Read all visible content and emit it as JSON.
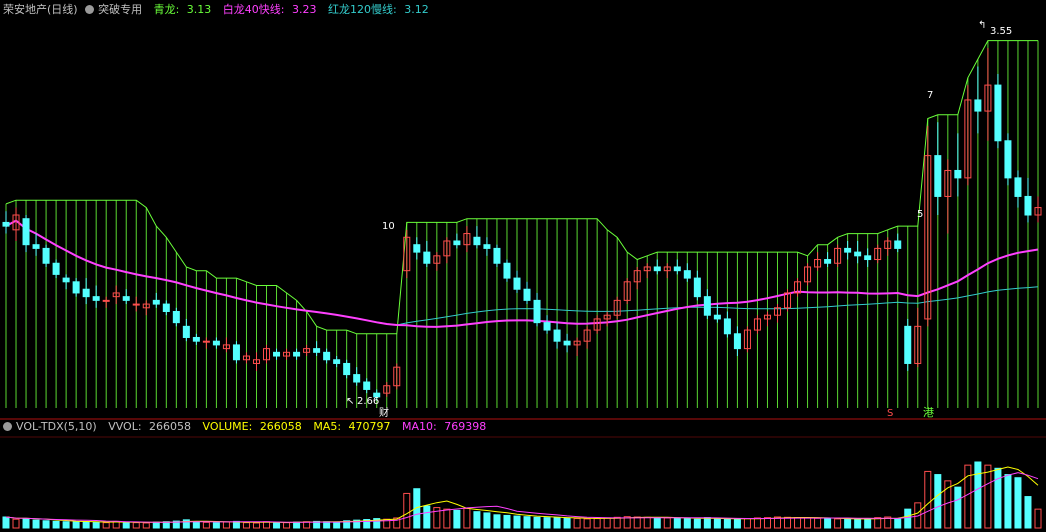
{
  "colors": {
    "up": "#ff4d4d",
    "down": "#54ffff",
    "green_band": "#6aff3a",
    "magenta": "#ff40ff",
    "cyan_line": "#33cccc",
    "yellow": "#ffff00",
    "white": "#ffffff",
    "separator": "#b01010"
  },
  "header": {
    "stock_name": "荣安地产(日线)",
    "indicator_name": "突破专用",
    "qinglong_label": "青龙: ",
    "qinglong_value": "3.13",
    "bailong_label": "白龙40快线: ",
    "bailong_value": "3.23",
    "honglong_label": "红龙120慢线: ",
    "honglong_value": "3.12"
  },
  "volume_header": {
    "name": "VOL-TDX(5,10)",
    "vvol_label": "VVOL: ",
    "vvol_value": "266058",
    "volume_label": "VOLUME: ",
    "volume_value": "266058",
    "ma5_label": "MA5: ",
    "ma5_value": "470797",
    "ma10_label": "MA10: ",
    "ma10_value": "769398"
  },
  "annotations": {
    "low_price": "2.66",
    "high_price": "3.55",
    "marker_cai": "财",
    "marker_s": "S",
    "marker_gang": "港",
    "num_10": "10",
    "num_7": "7",
    "num_5": "5"
  },
  "chart_data": [
    {
      "type": "candlestick",
      "title": "荣安地产(日线)",
      "ylim": [
        2.58,
        3.62
      ],
      "candles": [
        [
          3.08,
          3.11,
          3.05,
          3.07
        ],
        [
          3.06,
          3.12,
          3.03,
          3.1
        ],
        [
          3.09,
          3.1,
          3.0,
          3.02
        ],
        [
          3.02,
          3.05,
          2.99,
          3.01
        ],
        [
          3.01,
          3.02,
          2.96,
          2.97
        ],
        [
          2.97,
          2.98,
          2.93,
          2.94
        ],
        [
          2.93,
          2.94,
          2.9,
          2.92
        ],
        [
          2.92,
          2.93,
          2.88,
          2.89
        ],
        [
          2.9,
          2.93,
          2.86,
          2.88
        ],
        [
          2.88,
          2.91,
          2.85,
          2.87
        ],
        [
          2.87,
          2.88,
          2.85,
          2.87
        ],
        [
          2.88,
          2.91,
          2.86,
          2.89
        ],
        [
          2.88,
          2.9,
          2.86,
          2.87
        ],
        [
          2.86,
          2.88,
          2.84,
          2.86
        ],
        [
          2.85,
          2.87,
          2.83,
          2.86
        ],
        [
          2.87,
          2.89,
          2.85,
          2.86
        ],
        [
          2.86,
          2.87,
          2.83,
          2.84
        ],
        [
          2.84,
          2.85,
          2.8,
          2.81
        ],
        [
          2.8,
          2.82,
          2.76,
          2.77
        ],
        [
          2.77,
          2.78,
          2.75,
          2.76
        ],
        [
          2.76,
          2.77,
          2.74,
          2.76
        ],
        [
          2.76,
          2.77,
          2.74,
          2.75
        ],
        [
          2.74,
          2.77,
          2.73,
          2.75
        ],
        [
          2.75,
          2.76,
          2.7,
          2.71
        ],
        [
          2.71,
          2.73,
          2.7,
          2.72
        ],
        [
          2.7,
          2.73,
          2.68,
          2.71
        ],
        [
          2.71,
          2.75,
          2.7,
          2.74
        ],
        [
          2.73,
          2.74,
          2.71,
          2.72
        ],
        [
          2.72,
          2.74,
          2.71,
          2.73
        ],
        [
          2.73,
          2.74,
          2.71,
          2.72
        ],
        [
          2.73,
          2.75,
          2.72,
          2.74
        ],
        [
          2.74,
          2.76,
          2.72,
          2.73
        ],
        [
          2.73,
          2.74,
          2.7,
          2.71
        ],
        [
          2.71,
          2.72,
          2.69,
          2.7
        ],
        [
          2.7,
          2.71,
          2.66,
          2.67
        ],
        [
          2.67,
          2.69,
          2.64,
          2.65
        ],
        [
          2.65,
          2.66,
          2.62,
          2.63
        ],
        [
          2.62,
          2.63,
          2.6,
          2.61
        ],
        [
          2.62,
          2.65,
          2.61,
          2.64
        ],
        [
          2.64,
          2.7,
          2.63,
          2.69
        ],
        [
          2.95,
          3.06,
          2.93,
          3.04
        ],
        [
          3.02,
          3.04,
          2.98,
          3.0
        ],
        [
          3.0,
          3.03,
          2.96,
          2.97
        ],
        [
          2.97,
          3.0,
          2.95,
          2.99
        ],
        [
          2.99,
          3.04,
          2.97,
          3.03
        ],
        [
          3.03,
          3.05,
          3.01,
          3.02
        ],
        [
          3.02,
          3.07,
          3.0,
          3.05
        ],
        [
          3.04,
          3.07,
          3.01,
          3.02
        ],
        [
          3.02,
          3.04,
          2.99,
          3.01
        ],
        [
          3.01,
          3.02,
          2.96,
          2.97
        ],
        [
          2.97,
          2.98,
          2.92,
          2.93
        ],
        [
          2.93,
          2.95,
          2.89,
          2.9
        ],
        [
          2.9,
          2.92,
          2.86,
          2.87
        ],
        [
          2.87,
          2.89,
          2.8,
          2.81
        ],
        [
          2.81,
          2.83,
          2.78,
          2.79
        ],
        [
          2.79,
          2.81,
          2.74,
          2.76
        ],
        [
          2.76,
          2.78,
          2.73,
          2.75
        ],
        [
          2.75,
          2.77,
          2.72,
          2.76
        ],
        [
          2.76,
          2.8,
          2.74,
          2.79
        ],
        [
          2.79,
          2.83,
          2.78,
          2.82
        ],
        [
          2.82,
          2.84,
          2.8,
          2.83
        ],
        [
          2.83,
          2.88,
          2.82,
          2.87
        ],
        [
          2.87,
          2.93,
          2.86,
          2.92
        ],
        [
          2.92,
          2.96,
          2.9,
          2.95
        ],
        [
          2.95,
          2.97,
          2.93,
          2.96
        ],
        [
          2.96,
          2.98,
          2.94,
          2.95
        ],
        [
          2.95,
          2.97,
          2.93,
          2.96
        ],
        [
          2.96,
          2.98,
          2.94,
          2.95
        ],
        [
          2.95,
          2.97,
          2.92,
          2.93
        ],
        [
          2.93,
          2.95,
          2.87,
          2.88
        ],
        [
          2.88,
          2.9,
          2.82,
          2.83
        ],
        [
          2.83,
          2.86,
          2.81,
          2.82
        ],
        [
          2.82,
          2.84,
          2.77,
          2.78
        ],
        [
          2.78,
          2.8,
          2.72,
          2.74
        ],
        [
          2.74,
          2.8,
          2.73,
          2.79
        ],
        [
          2.79,
          2.83,
          2.78,
          2.82
        ],
        [
          2.82,
          2.84,
          2.8,
          2.83
        ],
        [
          2.83,
          2.86,
          2.81,
          2.85
        ],
        [
          2.85,
          2.9,
          2.84,
          2.89
        ],
        [
          2.89,
          2.93,
          2.88,
          2.92
        ],
        [
          2.92,
          2.97,
          2.91,
          2.96
        ],
        [
          2.96,
          3.0,
          2.95,
          2.98
        ],
        [
          2.98,
          3.0,
          2.96,
          2.97
        ],
        [
          2.97,
          3.02,
          2.96,
          3.01
        ],
        [
          3.01,
          3.03,
          2.98,
          3.0
        ],
        [
          3.0,
          3.03,
          2.97,
          2.99
        ],
        [
          2.99,
          3.01,
          2.96,
          2.98
        ],
        [
          2.98,
          3.02,
          2.97,
          3.01
        ],
        [
          3.01,
          3.04,
          2.99,
          3.03
        ],
        [
          3.03,
          3.05,
          3.0,
          3.01
        ],
        [
          2.8,
          2.82,
          2.68,
          2.7
        ],
        [
          2.7,
          2.85,
          2.69,
          2.8
        ],
        [
          2.82,
          3.34,
          2.8,
          3.26
        ],
        [
          3.26,
          3.35,
          3.1,
          3.15
        ],
        [
          3.15,
          3.25,
          3.05,
          3.22
        ],
        [
          3.22,
          3.32,
          3.15,
          3.2
        ],
        [
          3.2,
          3.45,
          3.18,
          3.41
        ],
        [
          3.41,
          3.5,
          3.32,
          3.38
        ],
        [
          3.38,
          3.55,
          3.3,
          3.45
        ],
        [
          3.45,
          3.48,
          3.28,
          3.3
        ],
        [
          3.3,
          3.32,
          3.18,
          3.2
        ],
        [
          3.2,
          3.22,
          3.12,
          3.15
        ],
        [
          3.15,
          3.2,
          3.08,
          3.1
        ],
        [
          3.1,
          3.15,
          3.08,
          3.12
        ]
      ]
    },
    {
      "type": "line",
      "series": [
        {
          "name": "青龙",
          "values": [
            3.13
          ]
        },
        {
          "name": "白龙40快线",
          "values": [
            3.23
          ]
        },
        {
          "name": "红龙120慢线",
          "values": [
            3.12
          ]
        }
      ]
    },
    {
      "type": "bar",
      "title": "VOL-TDX(5,10)",
      "ylim": [
        0,
        2800000
      ],
      "values": [
        350000,
        280000,
        300000,
        250000,
        230000,
        210000,
        200000,
        190000,
        200000,
        180000,
        170000,
        210000,
        180000,
        170000,
        160000,
        190000,
        200000,
        220000,
        260000,
        200000,
        180000,
        170000,
        190000,
        210000,
        170000,
        160000,
        200000,
        180000,
        170000,
        190000,
        200000,
        210000,
        200000,
        190000,
        230000,
        250000,
        270000,
        300000,
        280000,
        320000,
        1100000,
        1250000,
        700000,
        650000,
        600000,
        560000,
        620000,
        520000,
        480000,
        420000,
        400000,
        380000,
        360000,
        340000,
        330000,
        320000,
        310000,
        300000,
        290000,
        300000,
        320000,
        340000,
        360000,
        350000,
        340000,
        330000,
        320000,
        310000,
        300000,
        280000,
        330000,
        300000,
        290000,
        270000,
        300000,
        320000,
        330000,
        350000,
        340000,
        330000,
        320000,
        310000,
        300000,
        290000,
        280000,
        270000,
        300000,
        330000,
        350000,
        300000,
        600000,
        800000,
        1800000,
        1700000,
        1500000,
        1300000,
        2000000,
        2100000,
        2000000,
        1900000,
        1700000,
        1600000,
        1000000,
        600000
      ]
    }
  ]
}
